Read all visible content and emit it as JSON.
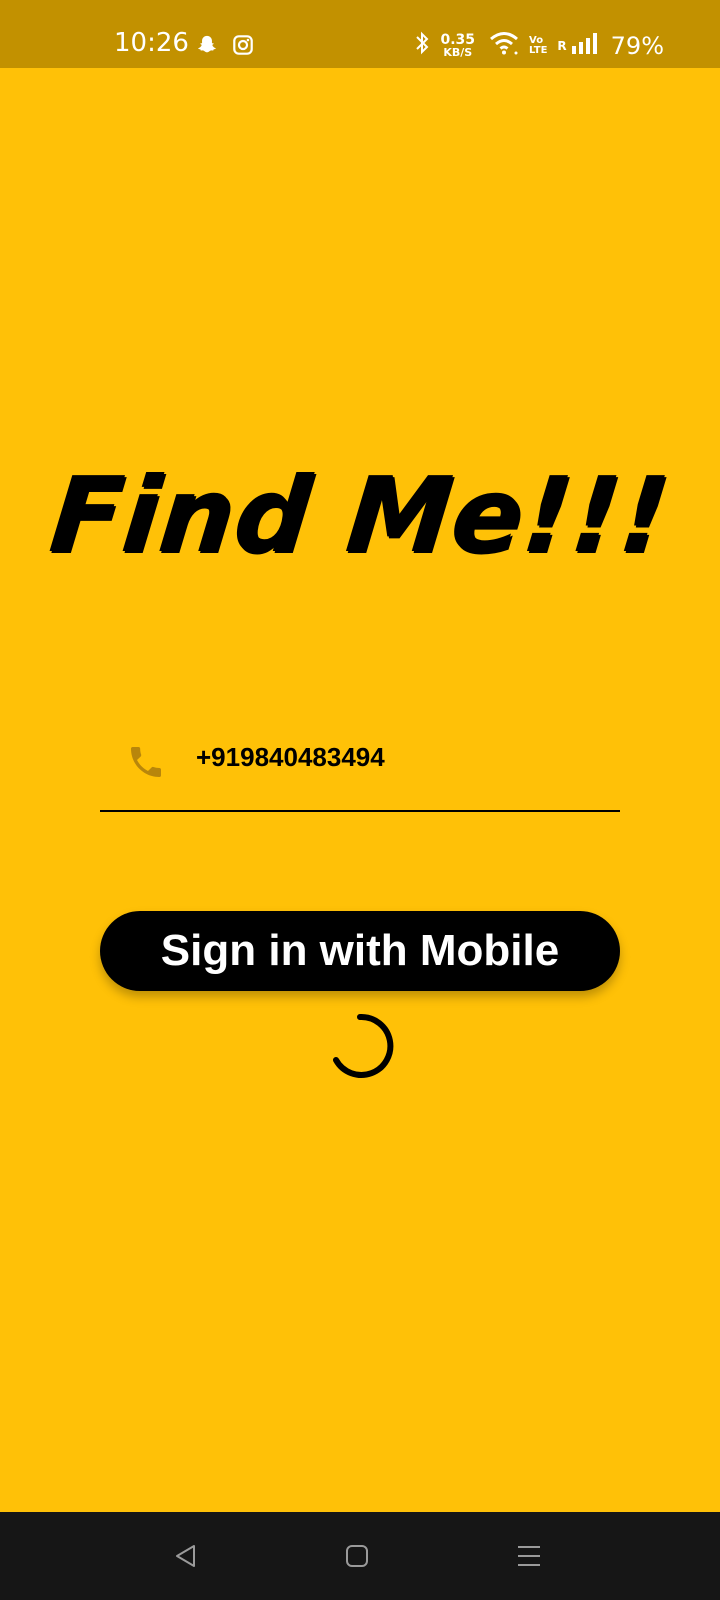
{
  "status_bar": {
    "time": "10:26",
    "net_speed_value": "0.35",
    "net_speed_unit": "KB/S",
    "volte_top": "Vo",
    "volte_bottom": "LTE",
    "roaming": "R",
    "battery": "79%",
    "left_icons": [
      "snapchat-icon",
      "instagram-icon"
    ],
    "right_icons": [
      "bluetooth-icon",
      "wifi-icon",
      "signal-icon"
    ]
  },
  "app": {
    "title": "Find Me!!!"
  },
  "phone_field": {
    "icon": "phone-icon",
    "value": "+919840483494"
  },
  "signin_button": {
    "label": "Sign in with Mobile"
  },
  "loading": {
    "icon": "loading-spinner"
  },
  "nav_bar": {
    "buttons": [
      "back-icon",
      "home-icon",
      "menu-icon"
    ]
  },
  "colors": {
    "background": "#FFC107",
    "status_bar": "#C29100",
    "icon_accent": "#B8860B",
    "button": "#000000",
    "nav_bar": "#161616"
  }
}
